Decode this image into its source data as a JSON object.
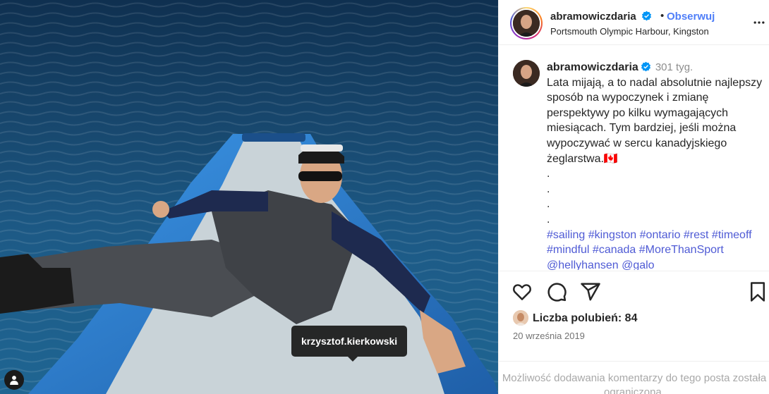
{
  "photo": {
    "tag_label": "krzysztof.kierkowski",
    "tagged_users_icon": "user-icon"
  },
  "post_header": {
    "username": "abramowiczdaria",
    "verified_icon": "verified-badge-icon",
    "separator": "•",
    "follow_label": "Obserwuj",
    "location": "Portsmouth Olympic Harbour, Kingston",
    "more_icon": "more-options-icon"
  },
  "caption": {
    "username": "abramowiczdaria",
    "time": "301 tyg.",
    "text": "Lata mijają, a to nadal absolutnie najlepszy sposób na wypoczynek i zmianę perspektywy po kilku wymagających miesiącach. Tym bardziej, jeśli można wypoczywać w sercu kanadyjskiego żeglarstwa.🇨🇦\n.\n.\n.\n.",
    "hashtags": "#sailing #kingston #ontario #rest #timeoff #mindful #canada #MoreThanSport @hellyhansen @galo"
  },
  "actions": {
    "like_icon": "heart-icon",
    "comment_icon": "comment-icon",
    "share_icon": "share-icon",
    "save_icon": "bookmark-icon"
  },
  "likes": {
    "label": "Liczba polubień:",
    "count": "84"
  },
  "date": "20 września 2019",
  "comments_notice": "Możliwość dodawania komentarzy do tego posta została ograniczona.",
  "colors": {
    "follow": "#4f7ef8",
    "hashtag": "#4f5bd5",
    "verified": "#0095f6",
    "boat": "#2e7fd0"
  }
}
